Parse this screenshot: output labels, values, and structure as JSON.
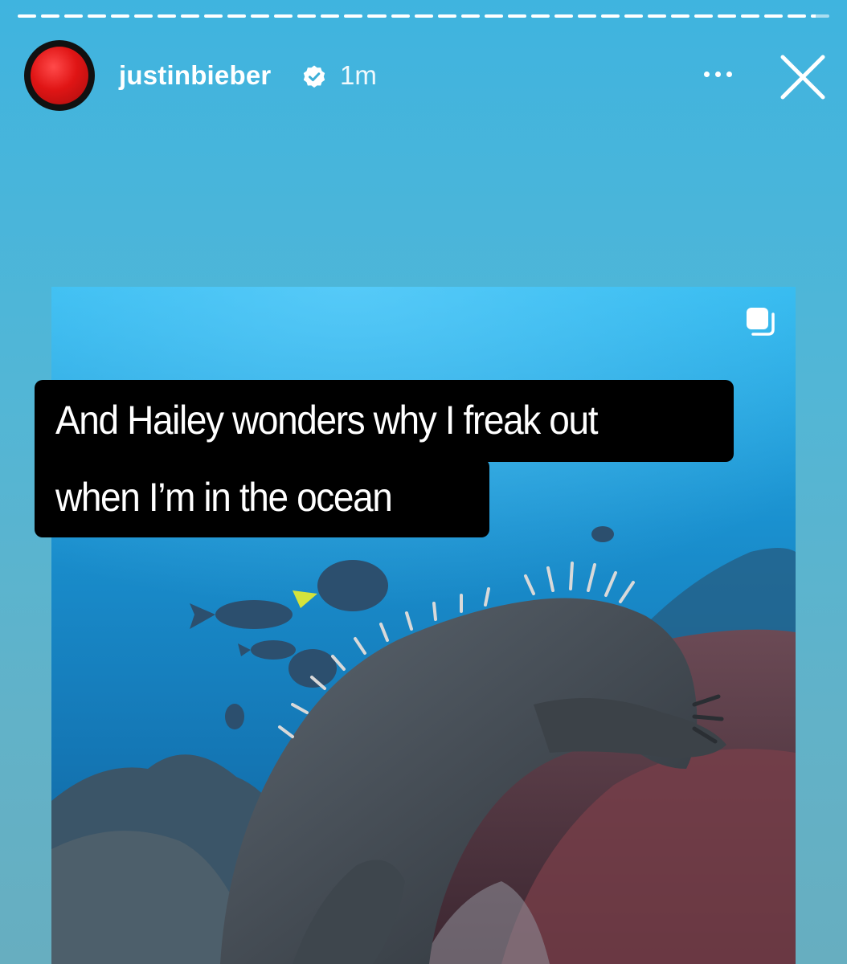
{
  "story": {
    "progress_segments": [
      1,
      1,
      1,
      1,
      1,
      1,
      1,
      1,
      1,
      1,
      1,
      1,
      1,
      1,
      1,
      1,
      1,
      1,
      1,
      1,
      1,
      1,
      1,
      1,
      1,
      1,
      1,
      1,
      1,
      1,
      1,
      1,
      1,
      1,
      0.25
    ],
    "header": {
      "username": "justinbieber",
      "verified": true,
      "time_ago": "1m",
      "more_icon": "more-horizontal-icon",
      "close_icon": "close-x-icon"
    },
    "reel": {
      "caption_line1": "And Hailey wonders why I freak out",
      "caption_line2": "when I’m in the ocean",
      "carousel_icon": "multiple-posts-icon"
    }
  },
  "colors": {
    "background_top": "#3fb4df",
    "background_bottom": "#67aec0",
    "avatar_red": "#e01515",
    "caption_bg": "#000000",
    "text": "#ffffff"
  }
}
